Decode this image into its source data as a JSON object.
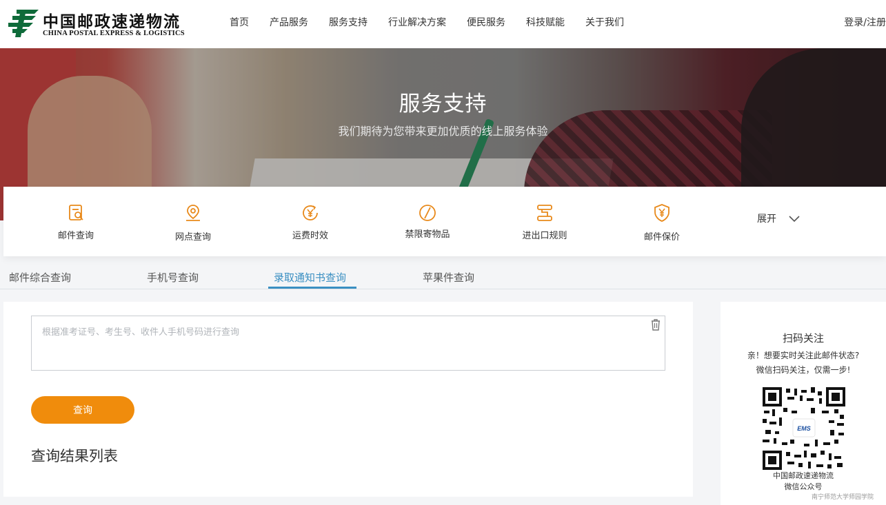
{
  "header": {
    "logo_cn": "中国邮政速递物流",
    "logo_en": "CHINA POSTAL EXPRESS & LOGISTICS",
    "nav": [
      "首页",
      "产品服务",
      "服务支持",
      "行业解决方案",
      "便民服务",
      "科技赋能",
      "关于我们"
    ],
    "login": "登录/注册"
  },
  "banner": {
    "title": "服务支持",
    "subtitle": "我们期待为您带来更加优质的线上服务体验"
  },
  "services": {
    "items": [
      {
        "label": "邮件查询",
        "icon": "mail-search-icon"
      },
      {
        "label": "网点查询",
        "icon": "location-pin-icon"
      },
      {
        "label": "运费时效",
        "icon": "yen-clock-icon"
      },
      {
        "label": "禁限寄物品",
        "icon": "prohibited-icon"
      },
      {
        "label": "进出口规则",
        "icon": "rules-icon"
      },
      {
        "label": "邮件保价",
        "icon": "yen-shield-icon"
      }
    ],
    "expand": "展开",
    "accent": "#e8891a"
  },
  "tabs": {
    "items": [
      "邮件综合查询",
      "手机号查询",
      "录取通知书查询",
      "苹果件查询"
    ],
    "active_index": 2,
    "active_color": "#3a8fc2"
  },
  "query": {
    "placeholder": "根据准考证号、考生号、收件人手机号码进行查询",
    "button": "查询",
    "button_color": "#f08c0c",
    "results_title": "查询结果列表"
  },
  "side": {
    "title": "扫码关注",
    "line1": "亲！想要实时关注此邮件状态?",
    "line2": "微信扫码关注，仅需一步!",
    "qr_center": "EMS",
    "org_line1": "中国邮政速递物流",
    "org_line2": "微信公众号"
  },
  "watermark": "南宁师范大学师园学院"
}
